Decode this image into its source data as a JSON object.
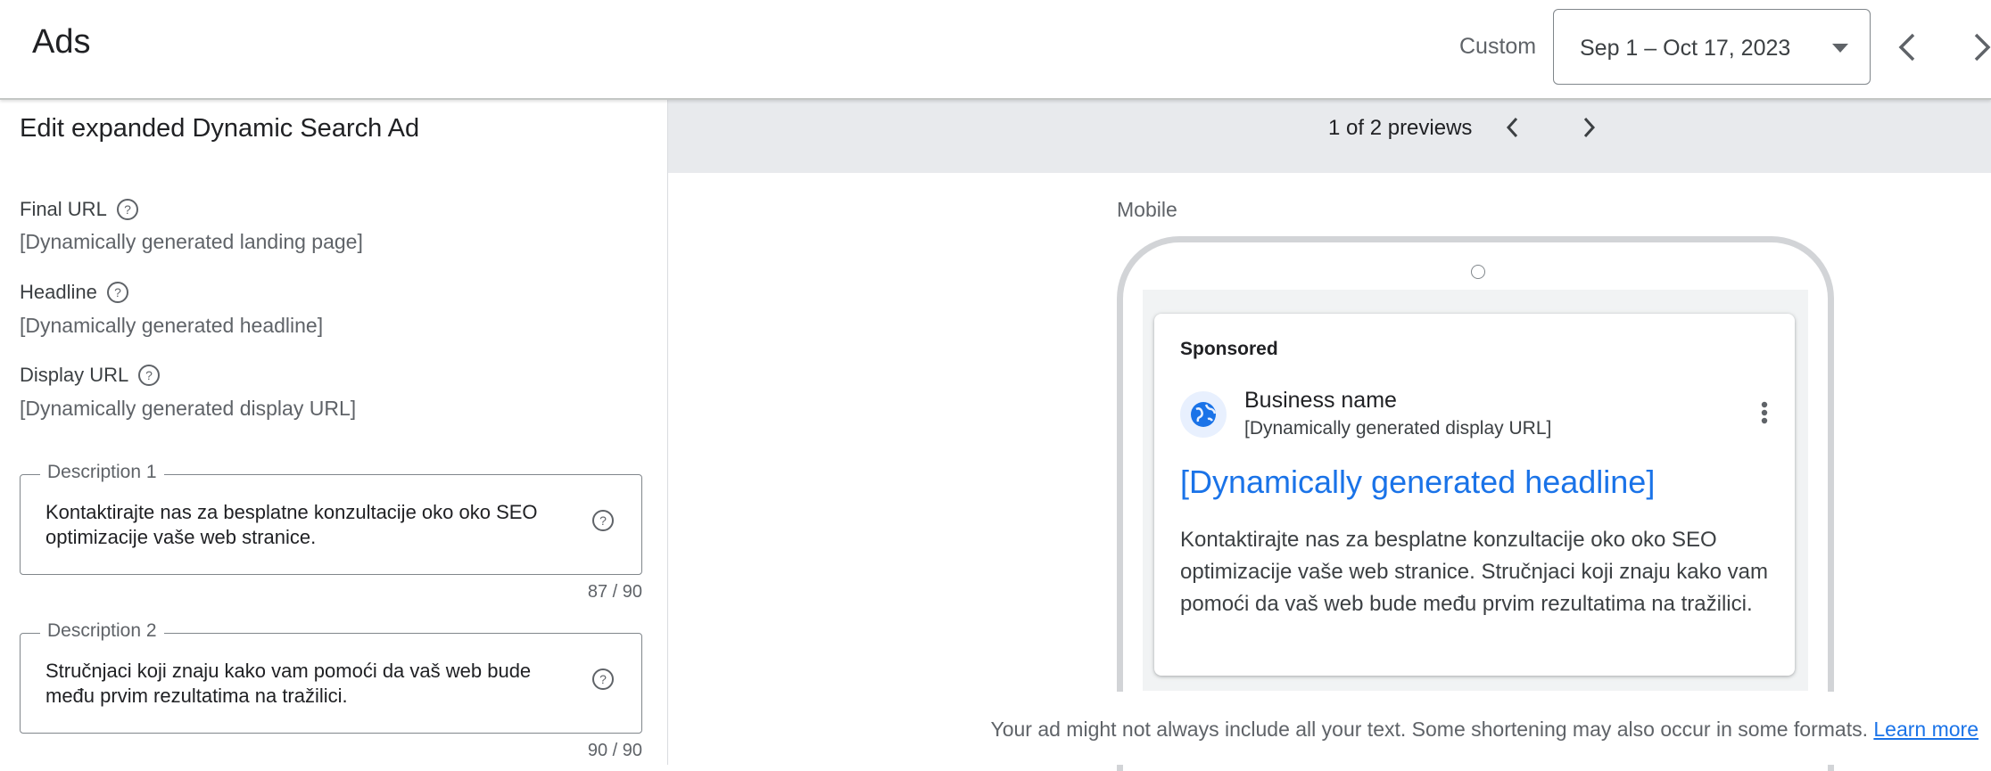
{
  "header": {
    "app_title": "Ads",
    "range_label": "Custom",
    "date_range": "Sep 1 – Oct 17, 2023"
  },
  "editor": {
    "title": "Edit expanded Dynamic Search Ad",
    "final_url_label": "Final URL",
    "final_url_value": "[Dynamically generated landing page]",
    "headline_label": "Headline",
    "headline_value": "[Dynamically generated headline]",
    "display_url_label": "Display URL",
    "display_url_value": "[Dynamically generated display URL]",
    "description1": {
      "label": "Description 1",
      "value": "Kontaktirajte nas za besplatne konzultacije oko oko SEO optimizacije vaše web stranice.",
      "counter": "87 / 90"
    },
    "description2": {
      "label": "Description 2",
      "value": "Stručnjaci koji znaju kako vam pomoći da vaš web bude među prvim rezultatima na tražilici.",
      "counter": "90 / 90"
    }
  },
  "preview": {
    "count_text": "1 of 2 previews",
    "device_label": "Mobile",
    "ad": {
      "sponsored": "Sponsored",
      "business_name": "Business name",
      "display_url": "[Dynamically generated display URL]",
      "headline": "[Dynamically generated headline]",
      "description": "Kontaktirajte nas za besplatne konzultacije oko oko SEO optimizacije vaše web stranice. Stručnjaci koji znaju kako vam pomoći da vaš web bude među prvim rezultatima na tražilici."
    },
    "disclaimer": "Your ad might not always include all your text. Some shortening may also occur in some formats.",
    "learn_more": "Learn more"
  },
  "colors": {
    "link": "#1a73e8",
    "preview_bar": "#e8eaed",
    "text_primary": "#202124",
    "text_secondary": "#5f6368"
  }
}
